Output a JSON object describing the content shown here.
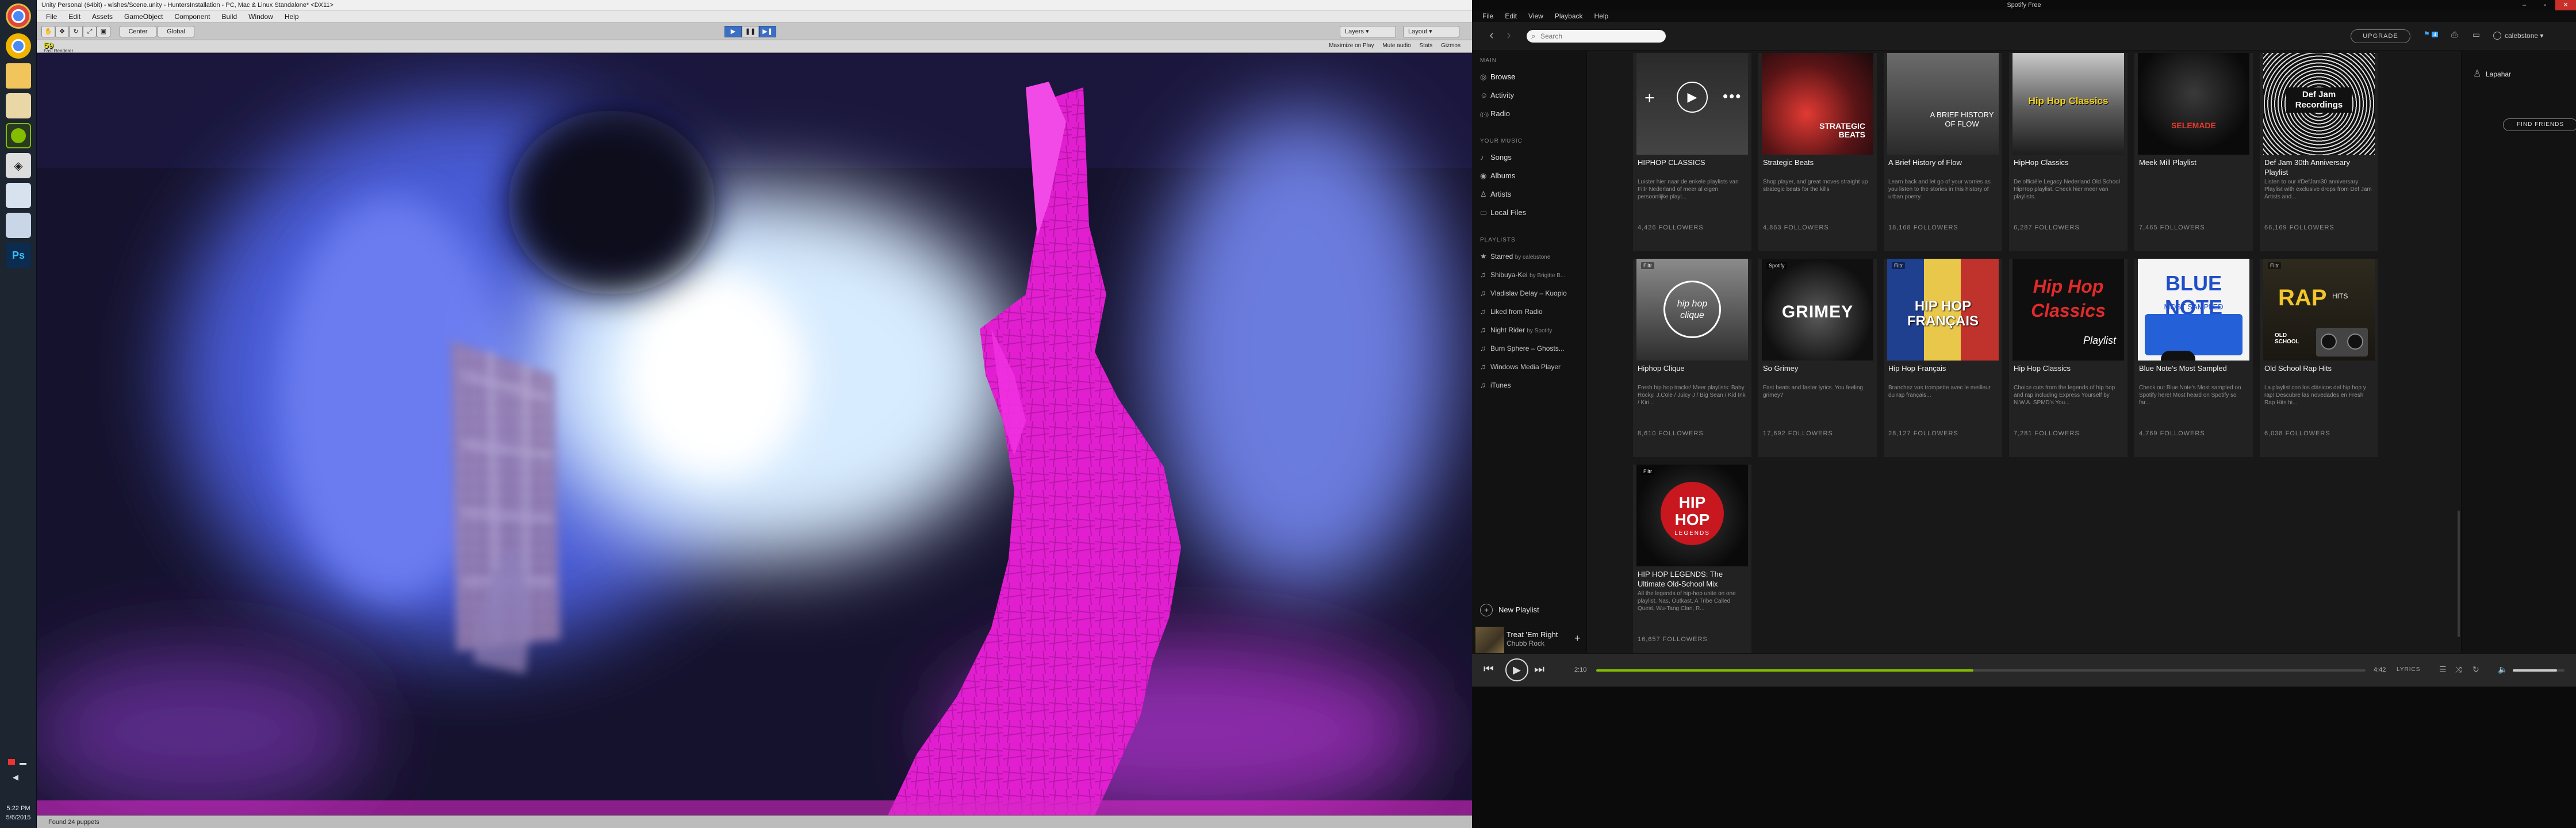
{
  "taskbar": {
    "icons": [
      "chrome-icon",
      "chrome-canary-icon",
      "folder-icon",
      "dev-folder-icon",
      "spotify-icon",
      "unity-icon",
      "file-icon",
      "document-icon",
      "photoshop-icon"
    ],
    "clock_time": "5:22 PM",
    "clock_date": "5/6/2015"
  },
  "unity": {
    "title": "Unity Personal (64bit) - wishes/Scene.unity - HuntersInstallation - PC, Mac & Linux Standalone* <DX11>",
    "menu": [
      "File",
      "Edit",
      "Assets",
      "GameObject",
      "Component",
      "Build",
      "Window",
      "Help"
    ],
    "tools": {
      "pivot": "Center",
      "space": "Global"
    },
    "layers_label": "Layers",
    "layout_label": "Layout",
    "fps": "59",
    "fps_sub": "Fast Renderer",
    "scene_options": [
      "Maximize on Play",
      "Mute audio",
      "Stats",
      "Gizmos"
    ],
    "status": "Found 24 puppets"
  },
  "spotify": {
    "title": "Spotify Free",
    "menu": [
      "File",
      "Edit",
      "View",
      "Playback",
      "Help"
    ],
    "search_placeholder": "Search",
    "upgrade_label": "UPGRADE",
    "notifications": "4",
    "username": "calebstone",
    "sidebar": {
      "main_heading": "MAIN",
      "main_items": [
        {
          "label": "Browse",
          "icon": "◎"
        },
        {
          "label": "Activity",
          "icon": "☺"
        },
        {
          "label": "Radio",
          "icon": "((·))"
        }
      ],
      "music_heading": "YOUR MUSIC",
      "music_items": [
        {
          "label": "Songs",
          "icon": "♪"
        },
        {
          "label": "Albums",
          "icon": "◉"
        },
        {
          "label": "Artists",
          "icon": "♙"
        },
        {
          "label": "Local Files",
          "icon": "▭"
        }
      ],
      "playlists_heading": "PLAYLISTS",
      "playlists": [
        {
          "label": "Starred",
          "by": "by calebstone",
          "icon": "★"
        },
        {
          "label": "Shibuya-Kei",
          "by": "by Brigitte B...",
          "icon": "♫"
        },
        {
          "label": "Vladislav Delay – Kuopio",
          "by": "",
          "icon": "♫"
        },
        {
          "label": "Liked from Radio",
          "by": "",
          "icon": "♫"
        },
        {
          "label": "Night Rider",
          "by": "by Spotify",
          "icon": "♫"
        },
        {
          "label": "Burn Sphere – Ghosts...",
          "by": "",
          "icon": "♫"
        },
        {
          "label": "Windows Media Player",
          "by": "",
          "icon": "♫"
        },
        {
          "label": "iTunes",
          "by": "",
          "icon": "♫"
        }
      ],
      "new_playlist": "New Playlist"
    },
    "now_playing": {
      "title": "Treat 'Em Right",
      "artist": "Chubb Rock"
    },
    "cards": [
      {
        "name": "HIPHOP CLASSICS",
        "desc": "Luister hier naar de enkele playlists van Filtr Nederland of meer al eigen persoonlijke playl...",
        "followers": "4,426 FOLLOWERS",
        "art": "dark-actions"
      },
      {
        "name": "Strategic Beats",
        "desc": "Shop player, and great moves straight up strategic beats for the kills",
        "followers": "4,863 FOLLOWERS",
        "art": "strategic"
      },
      {
        "name": "A Brief History of Flow",
        "desc": "Learn back and let go of your worries as you listen to the stories in this history of urban poetry.",
        "followers": "18,168 FOLLOWERS",
        "art": "history"
      },
      {
        "name": "HipHop Classics",
        "desc": "De officiële Legacy Nederland Old School HipHop playlist. Check hier meer van playlists.",
        "followers": "6,287 FOLLOWERS",
        "art": "hhclassics"
      },
      {
        "name": "Meek Mill Playlist",
        "desc": "",
        "followers": "7,465 FOLLOWERS",
        "art": "meek"
      },
      {
        "name": "Def Jam 30th Anniversary Playlist",
        "desc": "Listen to our #DefJam30 anniversary Playlist with exclusive drops from Def Jam Artists and...",
        "followers": "66,169 FOLLOWERS",
        "art": "defjam"
      },
      {
        "name": "Hiphop Clique",
        "desc": "Fresh hip hop tracks! Meer playlists: Baby Rocky, J.Cole / Juicy J / Big Sean / Kid Ink / Kiri...",
        "followers": "8,610 FOLLOWERS",
        "art": "clique"
      },
      {
        "name": "So Grimey",
        "desc": "Fast beats and faster lyrics. You feeling grimey?",
        "followers": "17,692 FOLLOWERS",
        "art": "grimey"
      },
      {
        "name": "Hip Hop Français",
        "desc": "Branchez vos trompette avec le meilleur du rap français...",
        "followers": "28,127 FOLLOWERS",
        "art": "francais"
      },
      {
        "name": "Hip Hop Classics",
        "desc": "Choice cuts from the legends of hip hop and rap including Express Yourself by N.W.A. SPMD's You...",
        "followers": "7,281 FOLLOWERS",
        "art": "hhc-playlist"
      },
      {
        "name": "Blue Note's Most Sampled",
        "desc": "Check out Blue Note's Most sampled on Spotify here! Most heard on Spotify so far...",
        "followers": "4,769 FOLLOWERS",
        "art": "bluenote"
      },
      {
        "name": "Old School Rap Hits",
        "desc": "La playlist con los clásicos del hip hop y rap! Descubre las novedades en Fresh Rap Hits hi...",
        "followers": "6,038 FOLLOWERS",
        "art": "oldschool"
      },
      {
        "name": "HIP HOP LEGENDS: The Ultimate Old-School Mix",
        "desc": "All the legends of hip-hop unite on one playlist. Nas, Outkast, A Tribe Called Quest, Wu-Tang Clan, R...",
        "followers": "16,657 FOLLOWERS",
        "art": "legends"
      }
    ],
    "art_text": {
      "strategic": "STRATEGIC BEATS",
      "history": "A BRIEF HISTORY OF FLOW",
      "hhclassics": "Hip Hop Classics",
      "meek": "SELEMADE",
      "defjam": "Def Jam Recordings",
      "clique": "hip hop clique",
      "grimey": "GRIMEY",
      "francais": "HIP HOP FRANÇAIS",
      "hhc_playlist_1": "Hip Hop",
      "hhc_playlist_2": "Classics",
      "hhc_playlist_3": "Playlist",
      "bluenote_1": "BLUE NOTE",
      "bluenote_2": "MOST SAMPLED",
      "oldschool_1": "RAP",
      "oldschool_2": "HITS",
      "oldschool_3": "OLD SCHOOL",
      "legends_1": "HIP",
      "legends_2": "HOP",
      "legends_3": "LEGENDS",
      "filtr": "Filtr",
      "spotify": "Spotify"
    },
    "friends": {
      "name": "Lapahar",
      "find_label": "FIND FRIENDS"
    },
    "player": {
      "elapsed": "2:10",
      "total": "4:42",
      "progress": 0.49,
      "lyrics_label": "LYRICS",
      "volume": 0.85
    }
  }
}
